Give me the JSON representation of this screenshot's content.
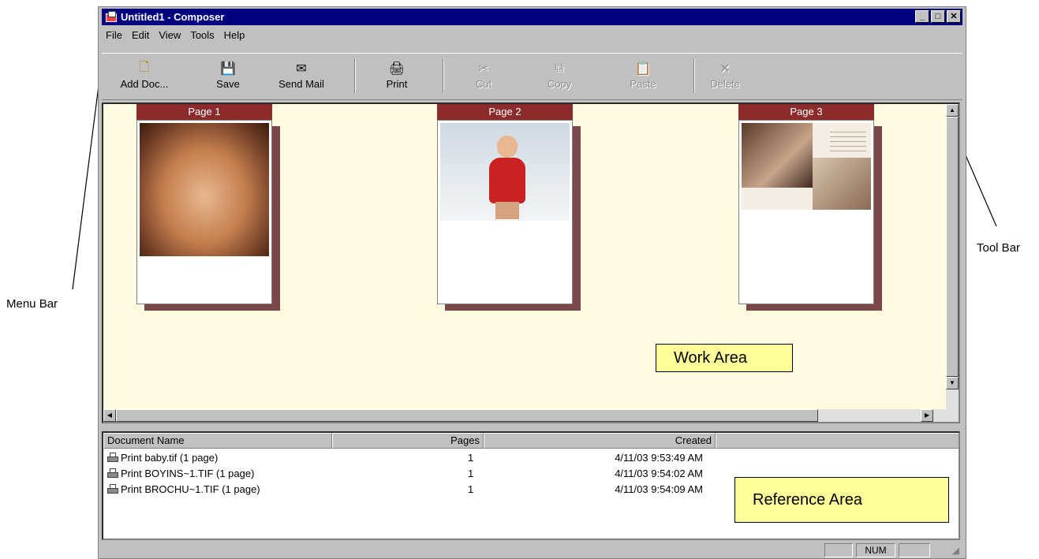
{
  "callouts": {
    "menu_bar": "Menu Bar",
    "tool_bar": "Tool Bar",
    "work_area": "Work Area",
    "reference_area": "Reference Area"
  },
  "window": {
    "title": "Untitled1 - Composer",
    "controls": [
      "minimize",
      "maximize",
      "close"
    ]
  },
  "menu": [
    "File",
    "Edit",
    "View",
    "Tools",
    "Help"
  ],
  "toolbar": [
    {
      "label": "Add Doc...",
      "icon": "add-document-icon",
      "enabled": true
    },
    {
      "label": "Save",
      "icon": "floppy-disk-icon",
      "enabled": true
    },
    {
      "label": "Send Mail",
      "icon": "envelope-icon",
      "enabled": true
    },
    {
      "label": "Print",
      "icon": "printer-icon",
      "enabled": true
    },
    {
      "label": "Cut",
      "icon": "scissors-icon",
      "enabled": false
    },
    {
      "label": "Copy",
      "icon": "copy-icon",
      "enabled": false
    },
    {
      "label": "Paste",
      "icon": "clipboard-icon",
      "enabled": false
    },
    {
      "label": "Delete",
      "icon": "x-icon",
      "enabled": false
    }
  ],
  "pages": [
    {
      "label": "Page 1"
    },
    {
      "label": "Page 2"
    },
    {
      "label": "Page 3"
    }
  ],
  "reference": {
    "columns": [
      "Document Name",
      "Pages",
      "Created"
    ],
    "rows": [
      {
        "name": "Print baby.tif (1 page)",
        "pages": "1",
        "created": "4/11/03 9:53:49 AM"
      },
      {
        "name": "Print BOYINS~1.TIF (1 page)",
        "pages": "1",
        "created": "4/11/03 9:54:02 AM"
      },
      {
        "name": "Print BROCHU~1.TIF (1 page)",
        "pages": "1",
        "created": "4/11/03 9:54:09 AM"
      }
    ]
  },
  "status": {
    "num": "NUM"
  },
  "colors": {
    "titlebar": "#000080",
    "page_header": "#8b2b2b",
    "work_area_bg": "#fffbe0",
    "callout_bg": "#ffff99"
  }
}
